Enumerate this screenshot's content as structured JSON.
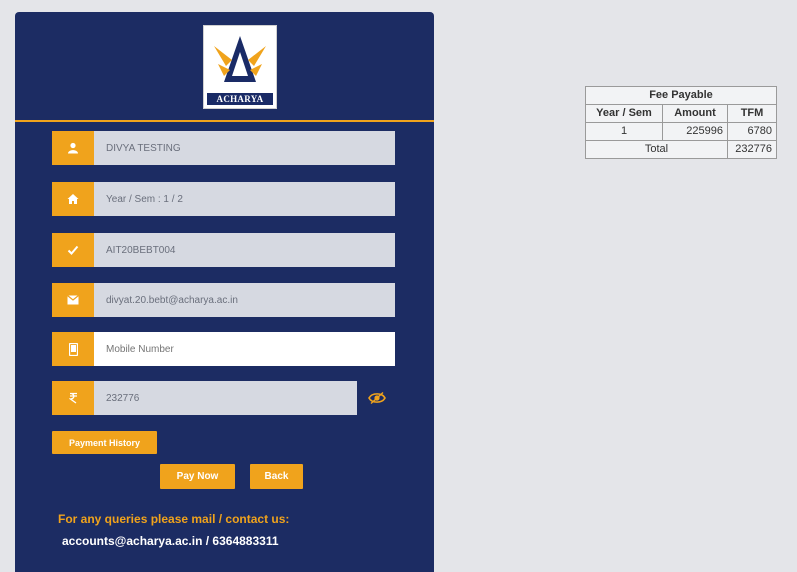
{
  "logo": {
    "text": "ACHARYA"
  },
  "form": {
    "name": "DIVYA TESTING",
    "year_sem": "Year / Sem : 1 / 2",
    "usn": "AIT20BEBT004",
    "email": "divyat.20.bebt@acharya.ac.in",
    "mobile_placeholder": "Mobile Number",
    "amount": "232776",
    "icons": [
      "user-icon",
      "home-icon",
      "check-icon",
      "envelope-icon",
      "mobile-icon",
      "rupee-icon",
      "eye-icon"
    ]
  },
  "buttons": {
    "payment_history": "Payment History",
    "pay_now": "Pay Now",
    "back": "Back"
  },
  "footer": {
    "query": "For any queries please mail / contact us:",
    "contact": "accounts@acharya.ac.in / 6364883311"
  },
  "fee_table": {
    "title": "Fee Payable",
    "headers": [
      "Year / Sem",
      "Amount",
      "TFM"
    ],
    "rows": [
      {
        "year_sem": "1",
        "amount": "225996",
        "tfm": "6780"
      }
    ],
    "total_label": "Total",
    "total_value": "232776"
  },
  "colors": {
    "card": "#1c2c63",
    "accent": "#f0a31c",
    "background": "#e4e5e9"
  }
}
